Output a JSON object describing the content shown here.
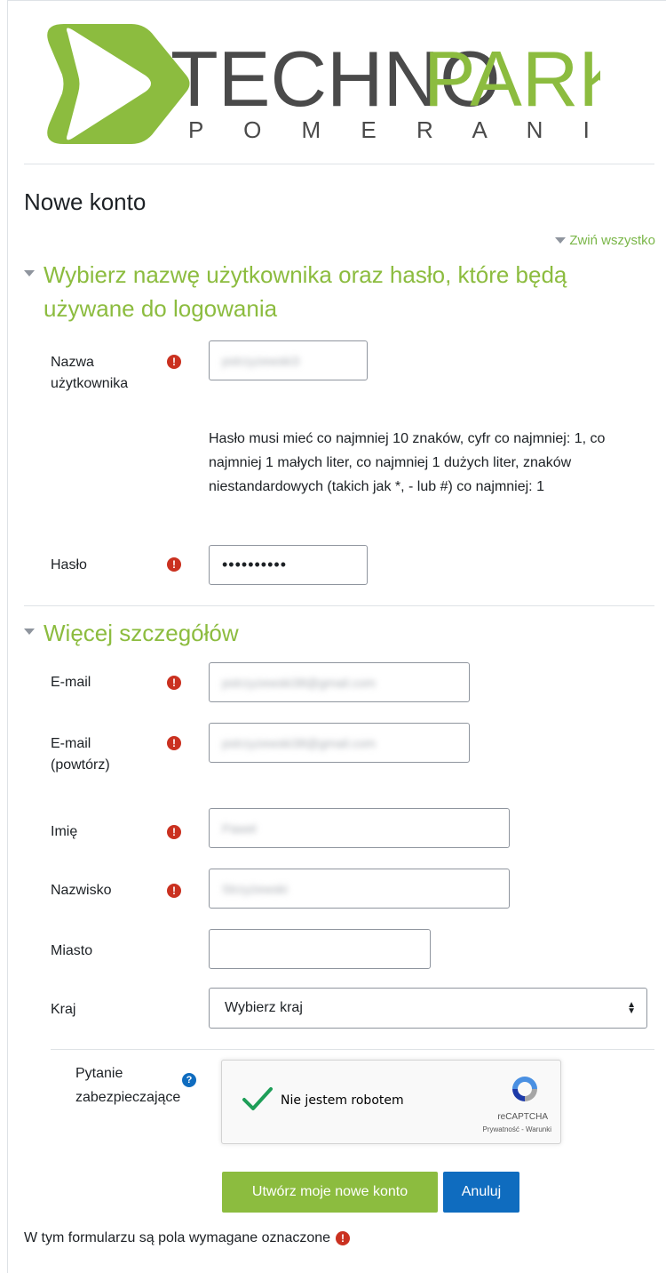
{
  "header": {
    "logo_word_dark": "TECHNO",
    "logo_word_green": "PARK",
    "logo_sub": "P O M E R A N I A"
  },
  "page_title": "Nowe konto",
  "collapse_all_label": "Zwiń wszystko",
  "section_login": {
    "title": "Wybierz nazwę użytkownika oraz hasło, które będą używane do logowania",
    "username_label": "Nazwa użytkownika",
    "username_value": "pstrzyzewski3",
    "password_hint": "Hasło musi mieć co najmniej 10 znaków, cyfr co najmniej: 1, co najmniej 1 małych liter, co najmniej 1 dużych liter, znaków niestandardowych (takich jak *, - lub #) co najmniej: 1",
    "password_label": "Hasło",
    "password_value": "••••••••••"
  },
  "section_details": {
    "title": "Więcej szczegółów",
    "email_label": "E-mail",
    "email_value": "pstrzyzewski38@gmail.com",
    "email_repeat_label": "E-mail (powtórz)",
    "email_repeat_value": "pstrzyzewski38@gmail.com",
    "firstname_label": "Imię",
    "firstname_value": "Paweł",
    "lastname_label": "Nazwisko",
    "lastname_value": "Strzyżewski",
    "city_label": "Miasto",
    "city_value": "",
    "country_label": "Kraj",
    "country_selected": "Wybierz kraj"
  },
  "security": {
    "label": "Pytanie zabezpieczające",
    "captcha_text": "Nie jestem robotem",
    "captcha_brand": "reCAPTCHA",
    "captcha_links": "Prywatność - Warunki"
  },
  "buttons": {
    "submit": "Utwórz moje nowe konto",
    "cancel": "Anuluj"
  },
  "footnote": "W tym formularzu są pola wymagane oznaczone",
  "icons": {
    "required": "!",
    "help": "?"
  },
  "colors": {
    "accent_green": "#8cbc3f",
    "primary_blue": "#0f6cbf",
    "required_red": "#ca3120"
  }
}
